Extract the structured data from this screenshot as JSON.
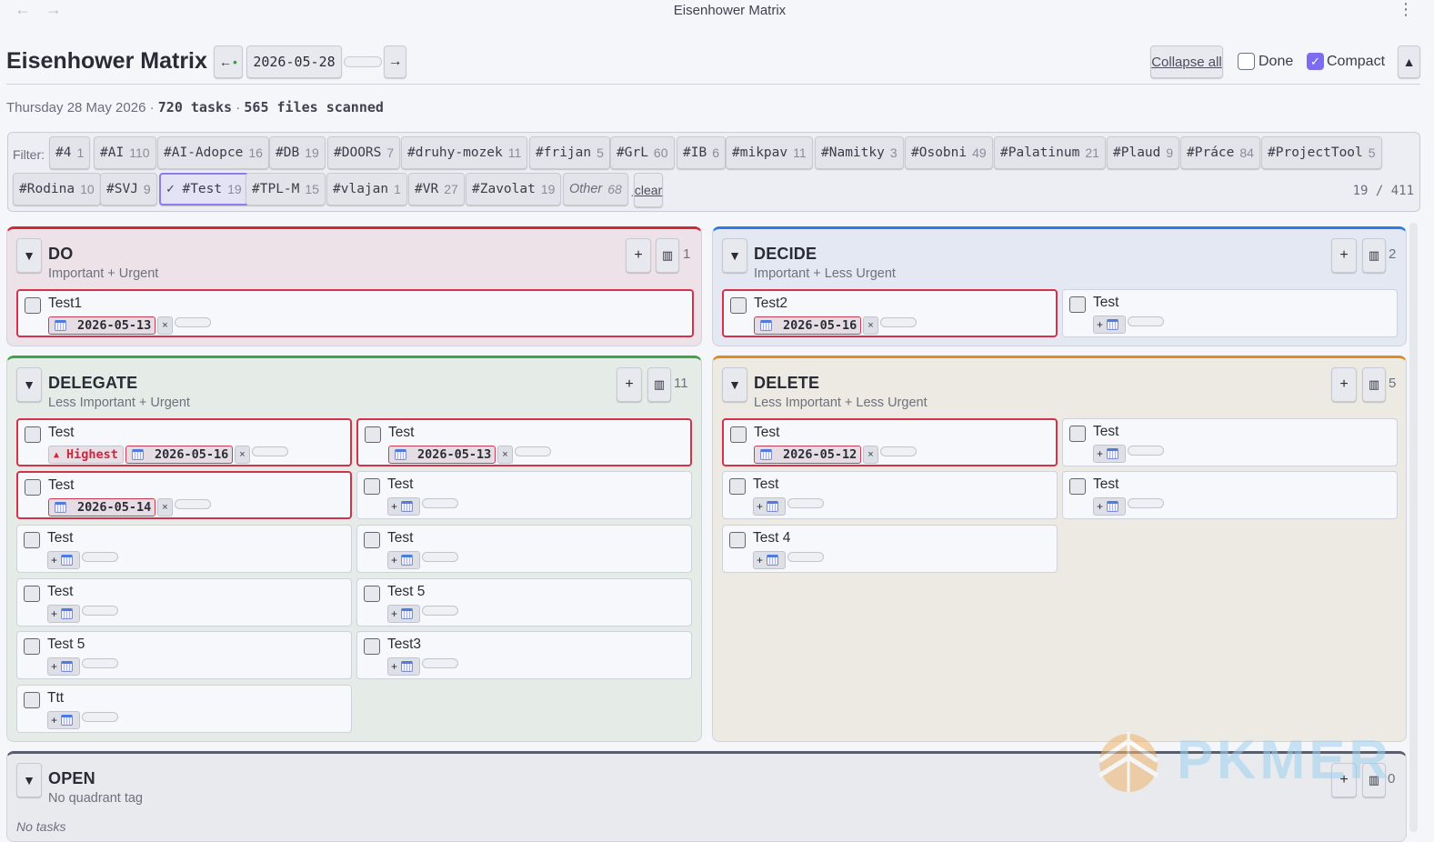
{
  "window": {
    "title": "Eisenhower Matrix",
    "back_icon": "←",
    "forward_icon": "→",
    "menu_icon": "⋮"
  },
  "header": {
    "title": "Eisenhower Matrix",
    "prev_label": "←",
    "prev_dot": "•",
    "date": "2026-05-28",
    "next_label": "→",
    "collapse_all": "Collapse all",
    "done_label": "Done",
    "done_checked": false,
    "compact_label": "Compact",
    "compact_checked": true,
    "up_label": "▲"
  },
  "meta": {
    "date_text": "Thursday 28 May 2026",
    "sep": "·",
    "tasks": "720 tasks",
    "files": "565 files scanned"
  },
  "filter": {
    "label": "Filter:",
    "chips": [
      {
        "tag": "#4",
        "count": "1"
      },
      {
        "tag": "#AI",
        "count": "110"
      },
      {
        "tag": "#AI-Adopce",
        "count": "16"
      },
      {
        "tag": "#DB",
        "count": "19"
      },
      {
        "tag": "#DOORS",
        "count": "7"
      },
      {
        "tag": "#druhy-mozek",
        "count": "11"
      },
      {
        "tag": "#frijan",
        "count": "5"
      },
      {
        "tag": "#GrL",
        "count": "60"
      },
      {
        "tag": "#IB",
        "count": "6"
      },
      {
        "tag": "#mikpav",
        "count": "11"
      },
      {
        "tag": "#Namitky",
        "count": "3"
      },
      {
        "tag": "#Osobni",
        "count": "49"
      },
      {
        "tag": "#Palatinum",
        "count": "21"
      },
      {
        "tag": "#Plaud",
        "count": "9"
      },
      {
        "tag": "#Práce",
        "count": "84"
      },
      {
        "tag": "#ProjectTool",
        "count": "5"
      },
      {
        "tag": "#Rodina",
        "count": "10"
      },
      {
        "tag": "#SVJ",
        "count": "9"
      },
      {
        "tag": "✓ #Test",
        "count": "19"
      },
      {
        "tag": "#TPL-M",
        "count": "15"
      },
      {
        "tag": "#vlajan",
        "count": "1"
      },
      {
        "tag": "#VR",
        "count": "27"
      },
      {
        "tag": "#Zavolat",
        "count": "19"
      },
      {
        "tag": "Other",
        "count": "68"
      }
    ],
    "selected": "#Test",
    "clear_sep": "·",
    "clear_label": "clear",
    "count_text": "19 / 411"
  },
  "quadrants": {
    "do": {
      "title": "DO",
      "subtitle": "Important + Urgent",
      "count": "1",
      "add": "+",
      "board_icon": "board-icon",
      "tasks": [
        {
          "title": "Test1",
          "due": "2026-05-13"
        }
      ]
    },
    "decide": {
      "title": "DECIDE",
      "subtitle": "Important + Less Urgent",
      "count": "2",
      "add": "+",
      "board_icon": "board-icon",
      "tasks": [
        {
          "title": "Test2",
          "due": "2026-05-16"
        },
        {
          "title": "Test",
          "due": ""
        }
      ]
    },
    "delegate": {
      "title": "DELEGATE",
      "subtitle": "Less Important + Urgent",
      "count": "11",
      "add": "+",
      "board_icon": "board-icon",
      "tasks": [
        {
          "title": "Test",
          "priority": "Highest",
          "due": "2026-05-16"
        },
        {
          "title": "Test",
          "due": "2026-05-13"
        },
        {
          "title": "Test",
          "due": "2026-05-14"
        },
        {
          "title": "Test",
          "due": ""
        },
        {
          "title": "Test",
          "due": ""
        },
        {
          "title": "Test",
          "due": ""
        },
        {
          "title": "Test",
          "due": ""
        },
        {
          "title": "Test 5",
          "due": ""
        },
        {
          "title": "Test 5",
          "due": ""
        },
        {
          "title": "Test3",
          "due": ""
        },
        {
          "title": "Ttt",
          "due": ""
        }
      ]
    },
    "delete": {
      "title": "DELETE",
      "subtitle": "Less Important + Less Urgent",
      "count": "5",
      "add": "+",
      "board_icon": "board-icon",
      "tasks": [
        {
          "title": "Test",
          "due": "2026-05-12"
        },
        {
          "title": "Test",
          "due": ""
        },
        {
          "title": "Test",
          "due": ""
        },
        {
          "title": "Test",
          "due": ""
        },
        {
          "title": "Test 4",
          "due": ""
        }
      ]
    },
    "open": {
      "title": "OPEN",
      "subtitle": "No quadrant tag",
      "count": "0",
      "add": "+",
      "board_icon": "board-icon",
      "empty_text": "No tasks"
    }
  },
  "ui": {
    "toggle": "▼",
    "plus": "+",
    "remove": "×",
    "priority_icon": "▲",
    "checkmark": "✓"
  },
  "colors": {
    "do": "#d6263c",
    "decide": "#2a7de3",
    "delegate": "#3ea549",
    "delete": "#e08a22",
    "open": "#5a5e6c",
    "accent": "#7b6cf0",
    "overdue": "#d2334b"
  },
  "watermark": "PKMER"
}
